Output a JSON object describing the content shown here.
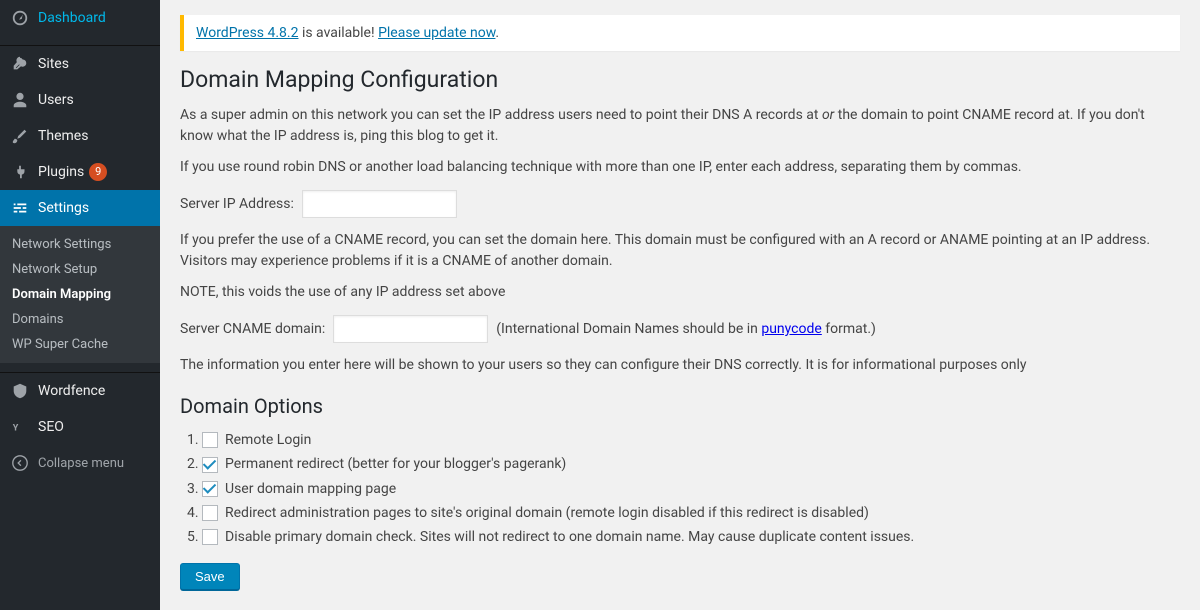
{
  "sidebar": {
    "items": [
      {
        "name": "dashboard",
        "label": "Dashboard",
        "icon": "dashboard"
      },
      {
        "name": "sites",
        "label": "Sites",
        "icon": "network"
      },
      {
        "name": "users",
        "label": "Users",
        "icon": "user"
      },
      {
        "name": "themes",
        "label": "Themes",
        "icon": "brush"
      },
      {
        "name": "plugins",
        "label": "Plugins",
        "icon": "plug",
        "badge": "9"
      },
      {
        "name": "settings",
        "label": "Settings",
        "icon": "sliders",
        "current": true
      }
    ],
    "sub": [
      {
        "name": "network-settings",
        "label": "Network Settings"
      },
      {
        "name": "network-setup",
        "label": "Network Setup"
      },
      {
        "name": "domain-mapping",
        "label": "Domain Mapping",
        "current": true
      },
      {
        "name": "domains",
        "label": "Domains"
      },
      {
        "name": "wp-super-cache",
        "label": "WP Super Cache"
      }
    ],
    "after": [
      {
        "name": "wordfence",
        "label": "Wordfence",
        "icon": "shield"
      },
      {
        "name": "seo",
        "label": "SEO",
        "icon": "seo"
      }
    ],
    "collapse": "Collapse menu"
  },
  "notice": {
    "link1": "WordPress 4.8.2",
    "mid": " is available! ",
    "link2": "Please update now",
    "end": "."
  },
  "page": {
    "title": "Domain Mapping Configuration",
    "intro_a": "As a super admin on this network you can set the IP address users need to point their DNS A records at ",
    "intro_or": "or",
    "intro_b": " the domain to point CNAME record at. If you don't know what the IP address is, ping this blog to get it.",
    "round_robin": "If you use round robin DNS or another load balancing technique with more than one IP, enter each address, separating them by commas.",
    "label_ip": "Server IP Address:",
    "val_ip": "",
    "cname_info": "If you prefer the use of a CNAME record, you can set the domain here. This domain must be configured with an A record or ANAME pointing at an IP address. Visitors may experience problems if it is a CNAME of another domain.",
    "cname_note": "NOTE, this voids the use of any IP address set above",
    "label_cname": "Server CNAME domain:",
    "val_cname": "",
    "cname_hint_a": "(International Domain Names should be in ",
    "cname_hint_link": "punycode",
    "cname_hint_b": " format.)",
    "info_line": "The information you enter here will be shown to your users so they can configure their DNS correctly. It is for informational purposes only",
    "options_title": "Domain Options",
    "options": [
      {
        "label": "Remote Login",
        "checked": false
      },
      {
        "label": "Permanent redirect (better for your blogger's pagerank)",
        "checked": true
      },
      {
        "label": "User domain mapping page",
        "checked": true
      },
      {
        "label": "Redirect administration pages to site's original domain (remote login disabled if this redirect is disabled)",
        "checked": false
      },
      {
        "label": "Disable primary domain check. Sites will not redirect to one domain name. May cause duplicate content issues.",
        "checked": false
      }
    ],
    "save": "Save"
  }
}
